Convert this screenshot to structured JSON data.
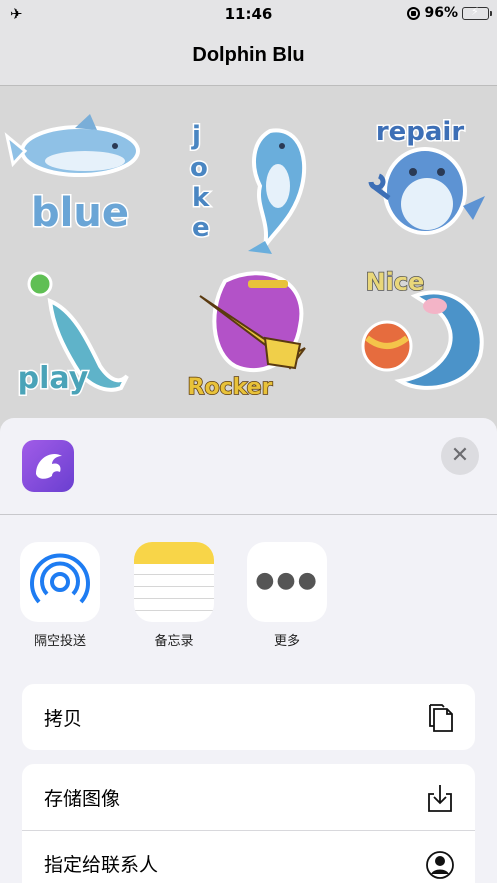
{
  "status_bar": {
    "time": "11:46",
    "battery": "96%",
    "airplane_icon": "airplane-icon"
  },
  "nav": {
    "title": "Dolphin Blu"
  },
  "stickers": [
    {
      "word": "blue",
      "color": "#7fb6df"
    },
    {
      "word": "joke",
      "color": "#6fa8dc"
    },
    {
      "word": "repair",
      "color": "#3d6fb6"
    },
    {
      "word": "play",
      "color": "#4aa3b8"
    },
    {
      "word": "Rocker",
      "color": "#b352c8"
    },
    {
      "word": "Nice",
      "color": "#e9d77a"
    }
  ],
  "share_sheet": {
    "app_icon": "dolphin-app-icon",
    "close_icon": "close-icon",
    "apps": [
      {
        "label": "隔空投送",
        "icon": "airdrop-icon"
      },
      {
        "label": "备忘录",
        "icon": "notes-icon"
      },
      {
        "label": "更多",
        "icon": "more-icon"
      }
    ],
    "actions_group_1": [
      {
        "label": "拷贝",
        "icon": "copy-icon"
      }
    ],
    "actions_group_2": [
      {
        "label": "存储图像",
        "icon": "save-image-icon"
      },
      {
        "label": "指定给联系人",
        "icon": "assign-contact-icon"
      }
    ]
  },
  "colors": {
    "accent": "#1e7cf2",
    "sheet_bg": "#f2f2f7",
    "notes_yellow": "#f8d548"
  }
}
